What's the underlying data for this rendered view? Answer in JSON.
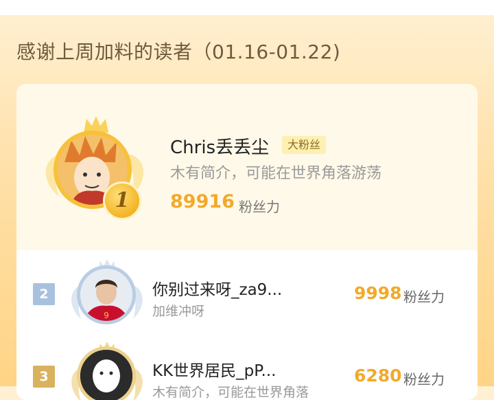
{
  "header": {
    "title": "感谢上周加料的读者（01.16-01.22)"
  },
  "top_fan": {
    "rank": "1",
    "name": "Chris丢丢尘",
    "tag": "大粉丝",
    "bio": "木有简介，可能在世界角落游荡",
    "score": "89916",
    "unit": "粉丝力"
  },
  "list": [
    {
      "rank": "2",
      "name": "你别过来呀_za9...",
      "bio": "加维冲呀",
      "score": "9998",
      "unit": "粉丝力"
    },
    {
      "rank": "3",
      "name": "KK世界居民_pP...",
      "bio": "木有简介，可能在世界角落",
      "score": "6280",
      "unit": "粉丝力"
    }
  ],
  "colors": {
    "accent": "#f2a92a",
    "gold": "#f7c13a",
    "silver": "#b9cde3",
    "bronze": "#d9b25f"
  },
  "icons": [
    "crown-icon",
    "laurel-wings-icon",
    "ghost-avatar-icon"
  ]
}
